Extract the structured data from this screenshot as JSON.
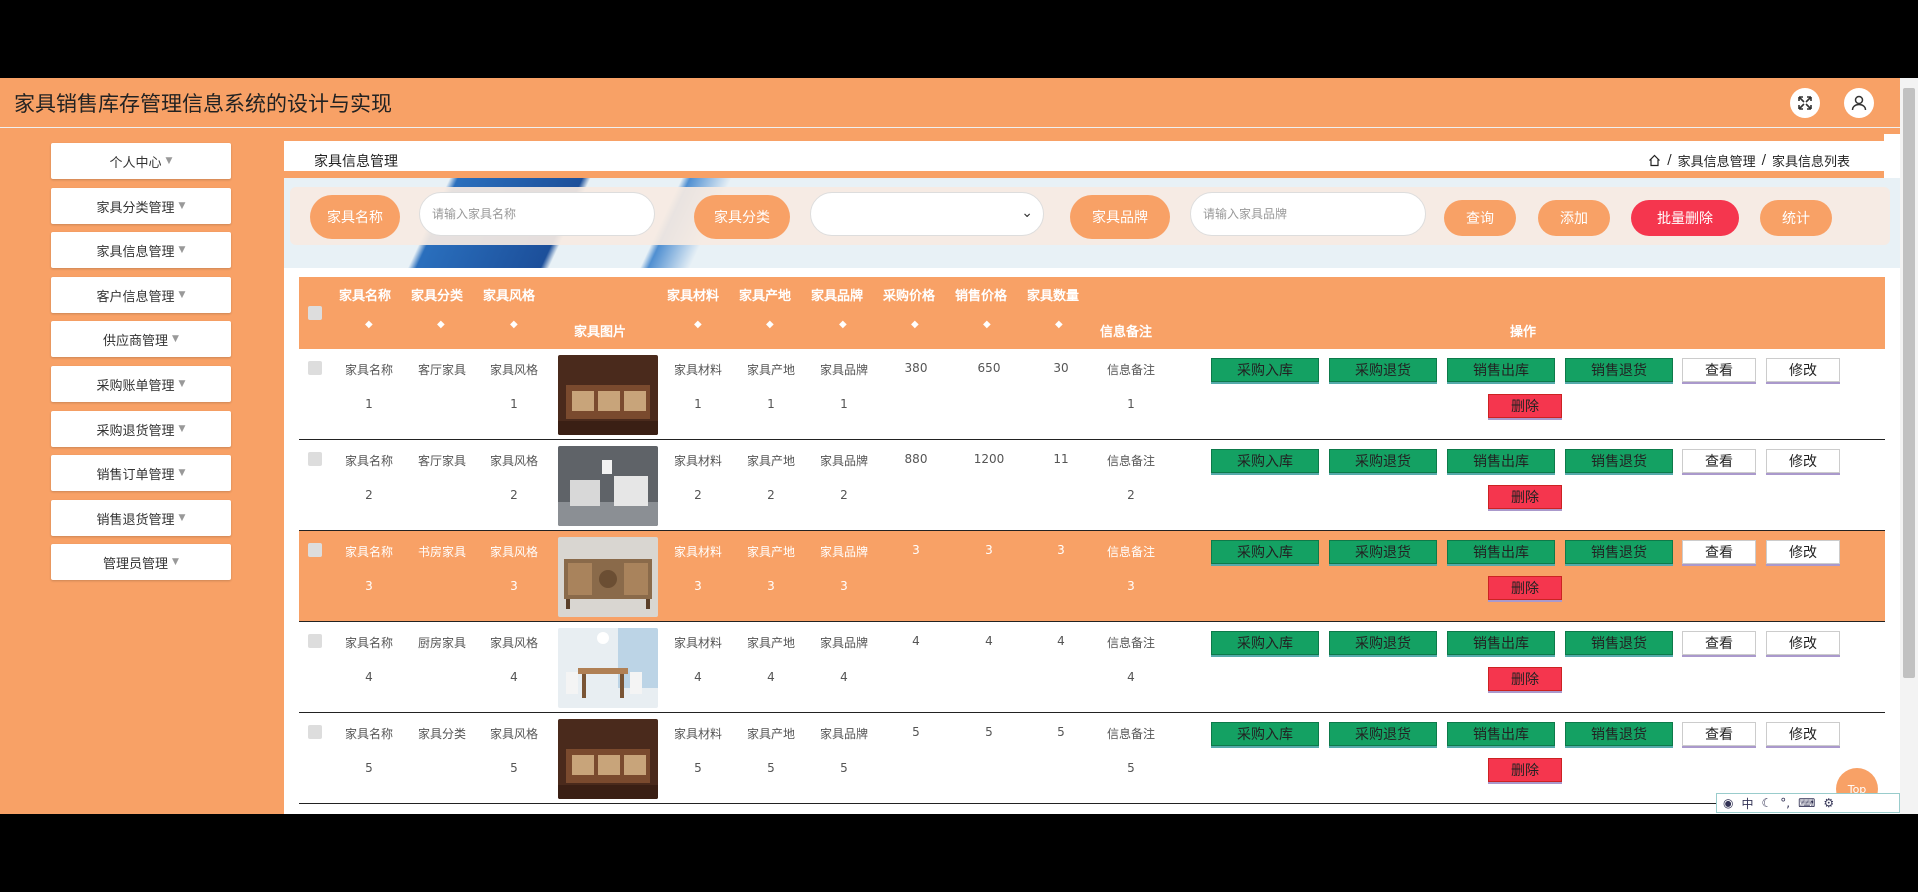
{
  "app": {
    "title": "家具销售库存管理信息系统的设计与实现",
    "accent_color": "#f8a166",
    "header_icons": [
      "fullscreen-icon",
      "user-icon"
    ]
  },
  "sidebar": {
    "items": [
      {
        "label": "个人中心"
      },
      {
        "label": "家具分类管理"
      },
      {
        "label": "家具信息管理"
      },
      {
        "label": "客户信息管理"
      },
      {
        "label": "供应商管理"
      },
      {
        "label": "采购账单管理"
      },
      {
        "label": "采购退货管理"
      },
      {
        "label": "销售订单管理"
      },
      {
        "label": "销售退货管理"
      },
      {
        "label": "管理员管理"
      }
    ]
  },
  "breadcrumb": {
    "title": "家具信息管理",
    "sep": "/",
    "level1": "家具信息管理",
    "level2": "家具信息列表"
  },
  "search": {
    "name_label": "家具名称",
    "name_placeholder": "请输入家具名称",
    "category_label": "家具分类",
    "brand_label": "家具品牌",
    "brand_placeholder": "请输入家具品牌",
    "query_btn": "查询",
    "add_btn": "添加",
    "batch_delete_btn": "批量删除",
    "stats_btn": "统计"
  },
  "table": {
    "headers": {
      "name": "家具名称",
      "category": "家具分类",
      "style": "家具风格",
      "image": "家具图片",
      "material": "家具材料",
      "origin": "家具产地",
      "brand": "家具品牌",
      "purchase_price": "采购价格",
      "sale_price": "销售价格",
      "quantity": "家具数量",
      "note": "信息备注",
      "actions": "操作"
    },
    "actions": {
      "purchase_in": "采购入库",
      "purchase_return": "采购退货",
      "sale_out": "销售出库",
      "sale_return": "销售退货",
      "view": "查看",
      "edit": "修改",
      "delete": "删除"
    },
    "rows": [
      {
        "name_a": "家具名称",
        "name_b": "1",
        "category": "客厅家具",
        "style_a": "家具风格",
        "style_b": "1",
        "material_a": "家具材料",
        "material_b": "1",
        "origin_a": "家具产地",
        "origin_b": "1",
        "brand_a": "家具品牌",
        "brand_b": "1",
        "purchase_price": "380",
        "sale_price": "650",
        "quantity": "30",
        "note_a": "信息备注",
        "note_b": "1"
      },
      {
        "name_a": "家具名称",
        "name_b": "2",
        "category": "客厅家具",
        "style_a": "家具风格",
        "style_b": "2",
        "material_a": "家具材料",
        "material_b": "2",
        "origin_a": "家具产地",
        "origin_b": "2",
        "brand_a": "家具品牌",
        "brand_b": "2",
        "purchase_price": "880",
        "sale_price": "1200",
        "quantity": "11",
        "note_a": "信息备注",
        "note_b": "2"
      },
      {
        "name_a": "家具名称",
        "name_b": "3",
        "category": "书房家具",
        "style_a": "家具风格",
        "style_b": "3",
        "material_a": "家具材料",
        "material_b": "3",
        "origin_a": "家具产地",
        "origin_b": "3",
        "brand_a": "家具品牌",
        "brand_b": "3",
        "purchase_price": "3",
        "sale_price": "3",
        "quantity": "3",
        "note_a": "信息备注",
        "note_b": "3"
      },
      {
        "name_a": "家具名称",
        "name_b": "4",
        "category": "厨房家具",
        "style_a": "家具风格",
        "style_b": "4",
        "material_a": "家具材料",
        "material_b": "4",
        "origin_a": "家具产地",
        "origin_b": "4",
        "brand_a": "家具品牌",
        "brand_b": "4",
        "purchase_price": "4",
        "sale_price": "4",
        "quantity": "4",
        "note_a": "信息备注",
        "note_b": "4"
      },
      {
        "name_a": "家具名称",
        "name_b": "5",
        "category": "家具分类",
        "style_a": "家具风格",
        "style_b": "5",
        "material_a": "家具材料",
        "material_b": "5",
        "origin_a": "家具产地",
        "origin_b": "5",
        "brand_a": "家具品牌",
        "brand_b": "5",
        "purchase_price": "5",
        "sale_price": "5",
        "quantity": "5",
        "note_a": "信息备注",
        "note_b": "5"
      }
    ]
  },
  "back_to_top": "Top",
  "ime": {
    "mode": "中"
  }
}
